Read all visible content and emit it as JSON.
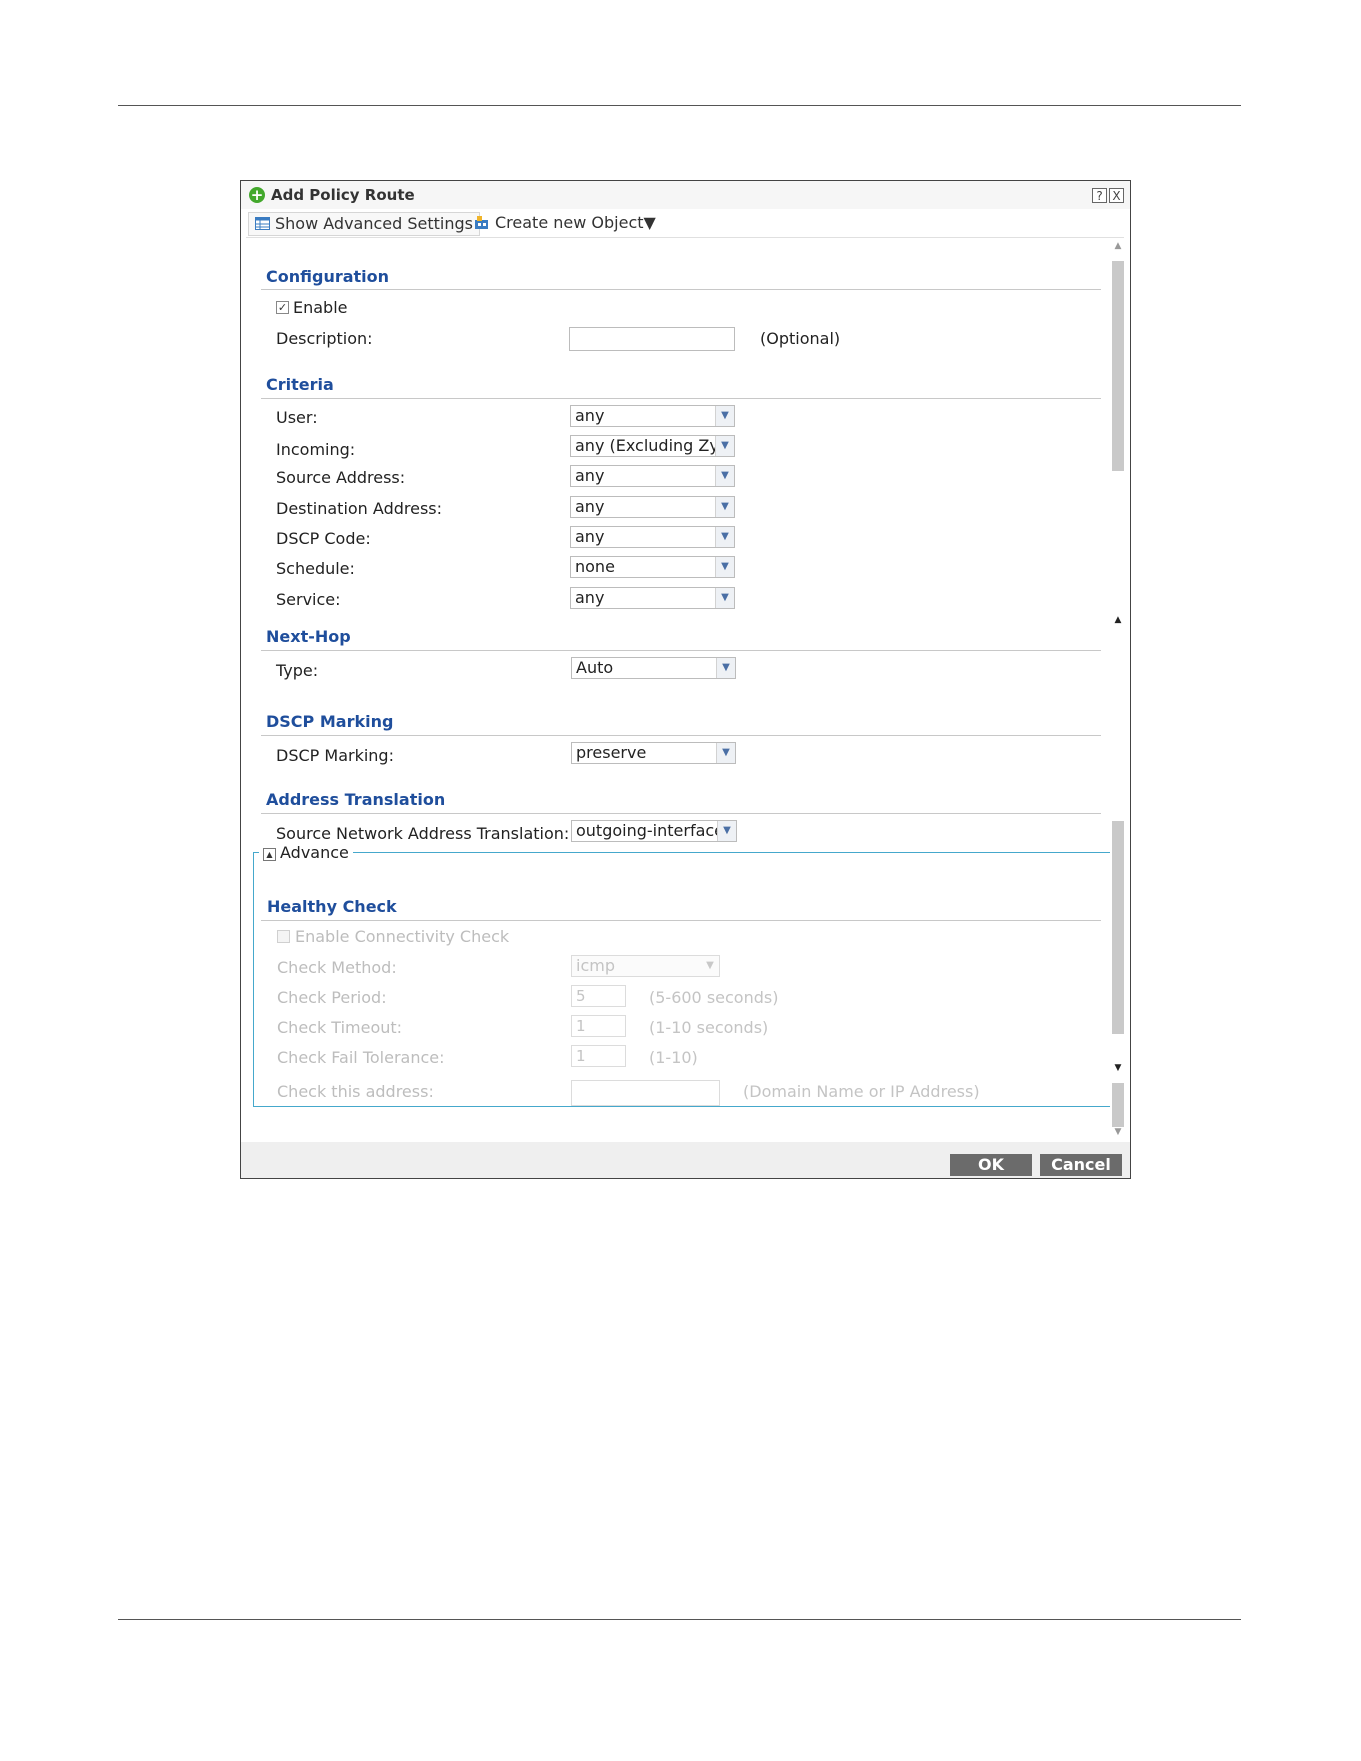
{
  "dialog": {
    "title": "Add Policy Route",
    "help_btn": "?",
    "close_btn": "X"
  },
  "toolbar": {
    "advanced": "Show Advanced Settings",
    "create": "Create new Object▼"
  },
  "configuration": {
    "title": "Configuration",
    "enable": "Enable",
    "enable_checked": true,
    "description_label": "Description:",
    "description_value": "",
    "optional": "(Optional)"
  },
  "criteria": {
    "title": "Criteria",
    "fields": [
      {
        "label": "User:",
        "value": "any"
      },
      {
        "label": "Incoming:",
        "value": "any (Excluding ZyW"
      },
      {
        "label": "Source Address:",
        "value": "any"
      },
      {
        "label": "Destination Address:",
        "value": "any"
      },
      {
        "label": "DSCP Code:",
        "value": "any"
      },
      {
        "label": "Schedule:",
        "value": "none"
      },
      {
        "label": "Service:",
        "value": "any"
      }
    ]
  },
  "nexthop": {
    "title": "Next-Hop",
    "type_label": "Type:",
    "type_value": "Auto"
  },
  "dscp": {
    "title": "DSCP Marking",
    "label": "DSCP Marking:",
    "value": "preserve"
  },
  "nat": {
    "title": "Address Translation",
    "label": "Source Network Address Translation:",
    "value": "outgoing-interface"
  },
  "advance": {
    "legend": "Advance",
    "toggle_glyph": "▲"
  },
  "healthy": {
    "title": "Healthy Check",
    "enable": "Enable Connectivity Check",
    "method_label": "Check Method:",
    "method_value": "icmp",
    "period_label": "Check Period:",
    "period_value": "5",
    "period_hint": "(5-600 seconds)",
    "timeout_label": "Check Timeout:",
    "timeout_value": "1",
    "timeout_hint": "(1-10 seconds)",
    "fail_label": "Check Fail Tolerance:",
    "fail_value": "1",
    "fail_hint": "(1-10)",
    "address_label": "Check this address:",
    "address_value": "",
    "address_hint": "(Domain Name or IP Address)"
  },
  "buttons": {
    "ok": "OK",
    "cancel": "Cancel"
  },
  "colors": {
    "section_title": "#1f4e9c",
    "advance_border": "#45a8cc",
    "button_bg": "#6b6b6b",
    "add_icon": "#43a82c"
  }
}
